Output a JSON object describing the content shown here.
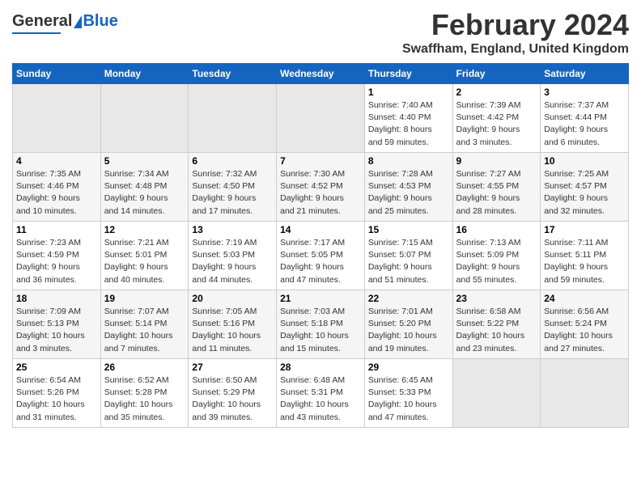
{
  "header": {
    "logo": {
      "general": "General",
      "blue": "Blue"
    },
    "title": "February 2024",
    "location": "Swaffham, England, United Kingdom"
  },
  "weekdays": [
    "Sunday",
    "Monday",
    "Tuesday",
    "Wednesday",
    "Thursday",
    "Friday",
    "Saturday"
  ],
  "weeks": [
    [
      {
        "day": "",
        "info": ""
      },
      {
        "day": "",
        "info": ""
      },
      {
        "day": "",
        "info": ""
      },
      {
        "day": "",
        "info": ""
      },
      {
        "day": "1",
        "info": "Sunrise: 7:40 AM\nSunset: 4:40 PM\nDaylight: 8 hours\nand 59 minutes."
      },
      {
        "day": "2",
        "info": "Sunrise: 7:39 AM\nSunset: 4:42 PM\nDaylight: 9 hours\nand 3 minutes."
      },
      {
        "day": "3",
        "info": "Sunrise: 7:37 AM\nSunset: 4:44 PM\nDaylight: 9 hours\nand 6 minutes."
      }
    ],
    [
      {
        "day": "4",
        "info": "Sunrise: 7:35 AM\nSunset: 4:46 PM\nDaylight: 9 hours\nand 10 minutes."
      },
      {
        "day": "5",
        "info": "Sunrise: 7:34 AM\nSunset: 4:48 PM\nDaylight: 9 hours\nand 14 minutes."
      },
      {
        "day": "6",
        "info": "Sunrise: 7:32 AM\nSunset: 4:50 PM\nDaylight: 9 hours\nand 17 minutes."
      },
      {
        "day": "7",
        "info": "Sunrise: 7:30 AM\nSunset: 4:52 PM\nDaylight: 9 hours\nand 21 minutes."
      },
      {
        "day": "8",
        "info": "Sunrise: 7:28 AM\nSunset: 4:53 PM\nDaylight: 9 hours\nand 25 minutes."
      },
      {
        "day": "9",
        "info": "Sunrise: 7:27 AM\nSunset: 4:55 PM\nDaylight: 9 hours\nand 28 minutes."
      },
      {
        "day": "10",
        "info": "Sunrise: 7:25 AM\nSunset: 4:57 PM\nDaylight: 9 hours\nand 32 minutes."
      }
    ],
    [
      {
        "day": "11",
        "info": "Sunrise: 7:23 AM\nSunset: 4:59 PM\nDaylight: 9 hours\nand 36 minutes."
      },
      {
        "day": "12",
        "info": "Sunrise: 7:21 AM\nSunset: 5:01 PM\nDaylight: 9 hours\nand 40 minutes."
      },
      {
        "day": "13",
        "info": "Sunrise: 7:19 AM\nSunset: 5:03 PM\nDaylight: 9 hours\nand 44 minutes."
      },
      {
        "day": "14",
        "info": "Sunrise: 7:17 AM\nSunset: 5:05 PM\nDaylight: 9 hours\nand 47 minutes."
      },
      {
        "day": "15",
        "info": "Sunrise: 7:15 AM\nSunset: 5:07 PM\nDaylight: 9 hours\nand 51 minutes."
      },
      {
        "day": "16",
        "info": "Sunrise: 7:13 AM\nSunset: 5:09 PM\nDaylight: 9 hours\nand 55 minutes."
      },
      {
        "day": "17",
        "info": "Sunrise: 7:11 AM\nSunset: 5:11 PM\nDaylight: 9 hours\nand 59 minutes."
      }
    ],
    [
      {
        "day": "18",
        "info": "Sunrise: 7:09 AM\nSunset: 5:13 PM\nDaylight: 10 hours\nand 3 minutes."
      },
      {
        "day": "19",
        "info": "Sunrise: 7:07 AM\nSunset: 5:14 PM\nDaylight: 10 hours\nand 7 minutes."
      },
      {
        "day": "20",
        "info": "Sunrise: 7:05 AM\nSunset: 5:16 PM\nDaylight: 10 hours\nand 11 minutes."
      },
      {
        "day": "21",
        "info": "Sunrise: 7:03 AM\nSunset: 5:18 PM\nDaylight: 10 hours\nand 15 minutes."
      },
      {
        "day": "22",
        "info": "Sunrise: 7:01 AM\nSunset: 5:20 PM\nDaylight: 10 hours\nand 19 minutes."
      },
      {
        "day": "23",
        "info": "Sunrise: 6:58 AM\nSunset: 5:22 PM\nDaylight: 10 hours\nand 23 minutes."
      },
      {
        "day": "24",
        "info": "Sunrise: 6:56 AM\nSunset: 5:24 PM\nDaylight: 10 hours\nand 27 minutes."
      }
    ],
    [
      {
        "day": "25",
        "info": "Sunrise: 6:54 AM\nSunset: 5:26 PM\nDaylight: 10 hours\nand 31 minutes."
      },
      {
        "day": "26",
        "info": "Sunrise: 6:52 AM\nSunset: 5:28 PM\nDaylight: 10 hours\nand 35 minutes."
      },
      {
        "day": "27",
        "info": "Sunrise: 6:50 AM\nSunset: 5:29 PM\nDaylight: 10 hours\nand 39 minutes."
      },
      {
        "day": "28",
        "info": "Sunrise: 6:48 AM\nSunset: 5:31 PM\nDaylight: 10 hours\nand 43 minutes."
      },
      {
        "day": "29",
        "info": "Sunrise: 6:45 AM\nSunset: 5:33 PM\nDaylight: 10 hours\nand 47 minutes."
      },
      {
        "day": "",
        "info": ""
      },
      {
        "day": "",
        "info": ""
      }
    ]
  ]
}
